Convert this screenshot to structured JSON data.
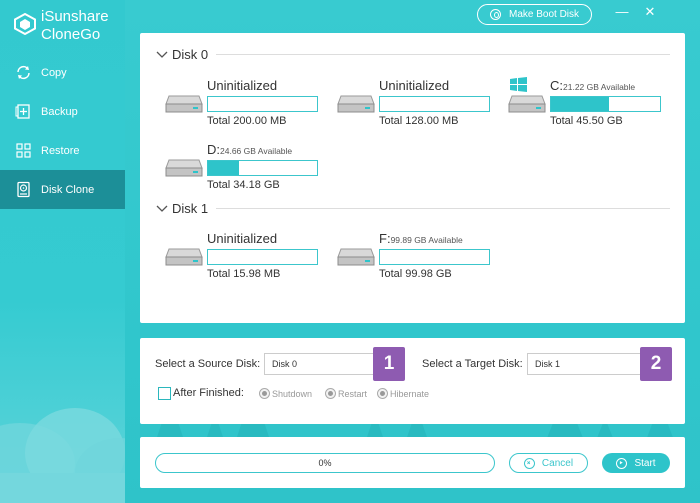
{
  "app": {
    "name_line1": "iSunshare",
    "name_line2": "CloneGo"
  },
  "sidebar": {
    "items": [
      {
        "label": "Copy",
        "icon": "copy-icon",
        "active": false
      },
      {
        "label": "Backup",
        "icon": "backup-icon",
        "active": false
      },
      {
        "label": "Restore",
        "icon": "restore-icon",
        "active": false
      },
      {
        "label": "Disk Clone",
        "icon": "disk-clone-icon",
        "active": true
      }
    ]
  },
  "titlebar": {
    "boot_label": "Make Boot Disk",
    "minimize": "—",
    "close": "✕"
  },
  "disks": [
    {
      "label": "Disk 0",
      "partitions": [
        {
          "name": "Uninitialized",
          "available": "",
          "total": "Total 200.00 MB",
          "used_fraction": 0,
          "type": "drive"
        },
        {
          "name": "Uninitialized",
          "available": "",
          "total": "Total 128.00 MB",
          "used_fraction": 0,
          "type": "drive"
        },
        {
          "name": "C:",
          "available": "21.22 GB Available",
          "total": "Total 45.50 GB",
          "used_fraction": 0.53,
          "type": "windows"
        },
        {
          "name": "D:",
          "available": "24.66 GB Available",
          "total": "Total 34.18 GB",
          "used_fraction": 0.28,
          "type": "drive"
        }
      ]
    },
    {
      "label": "Disk 1",
      "partitions": [
        {
          "name": "Uninitialized",
          "available": "",
          "total": "Total 15.98 MB",
          "used_fraction": 0,
          "type": "drive"
        },
        {
          "name": "F:",
          "available": "99.89 GB Available",
          "total": "Total 99.98 GB",
          "used_fraction": 0,
          "type": "drive"
        }
      ]
    }
  ],
  "options": {
    "source_label": "Select a Source Disk:",
    "source_value": "Disk 0",
    "source_badge": "1",
    "target_label": "Select a Target Disk:",
    "target_value": "Disk 1",
    "target_badge": "2",
    "after_label": "After Finished:",
    "after_checked": false,
    "radios": [
      "Shutdown",
      "Restart",
      "Hibernate"
    ]
  },
  "progress": {
    "value_text": "0%",
    "fraction": 0
  },
  "buttons": {
    "cancel": "Cancel",
    "start": "Start"
  },
  "colors": {
    "accent": "#2ec4ca",
    "active_nav": "#1c8f98",
    "badge": "#8e5bb1"
  }
}
